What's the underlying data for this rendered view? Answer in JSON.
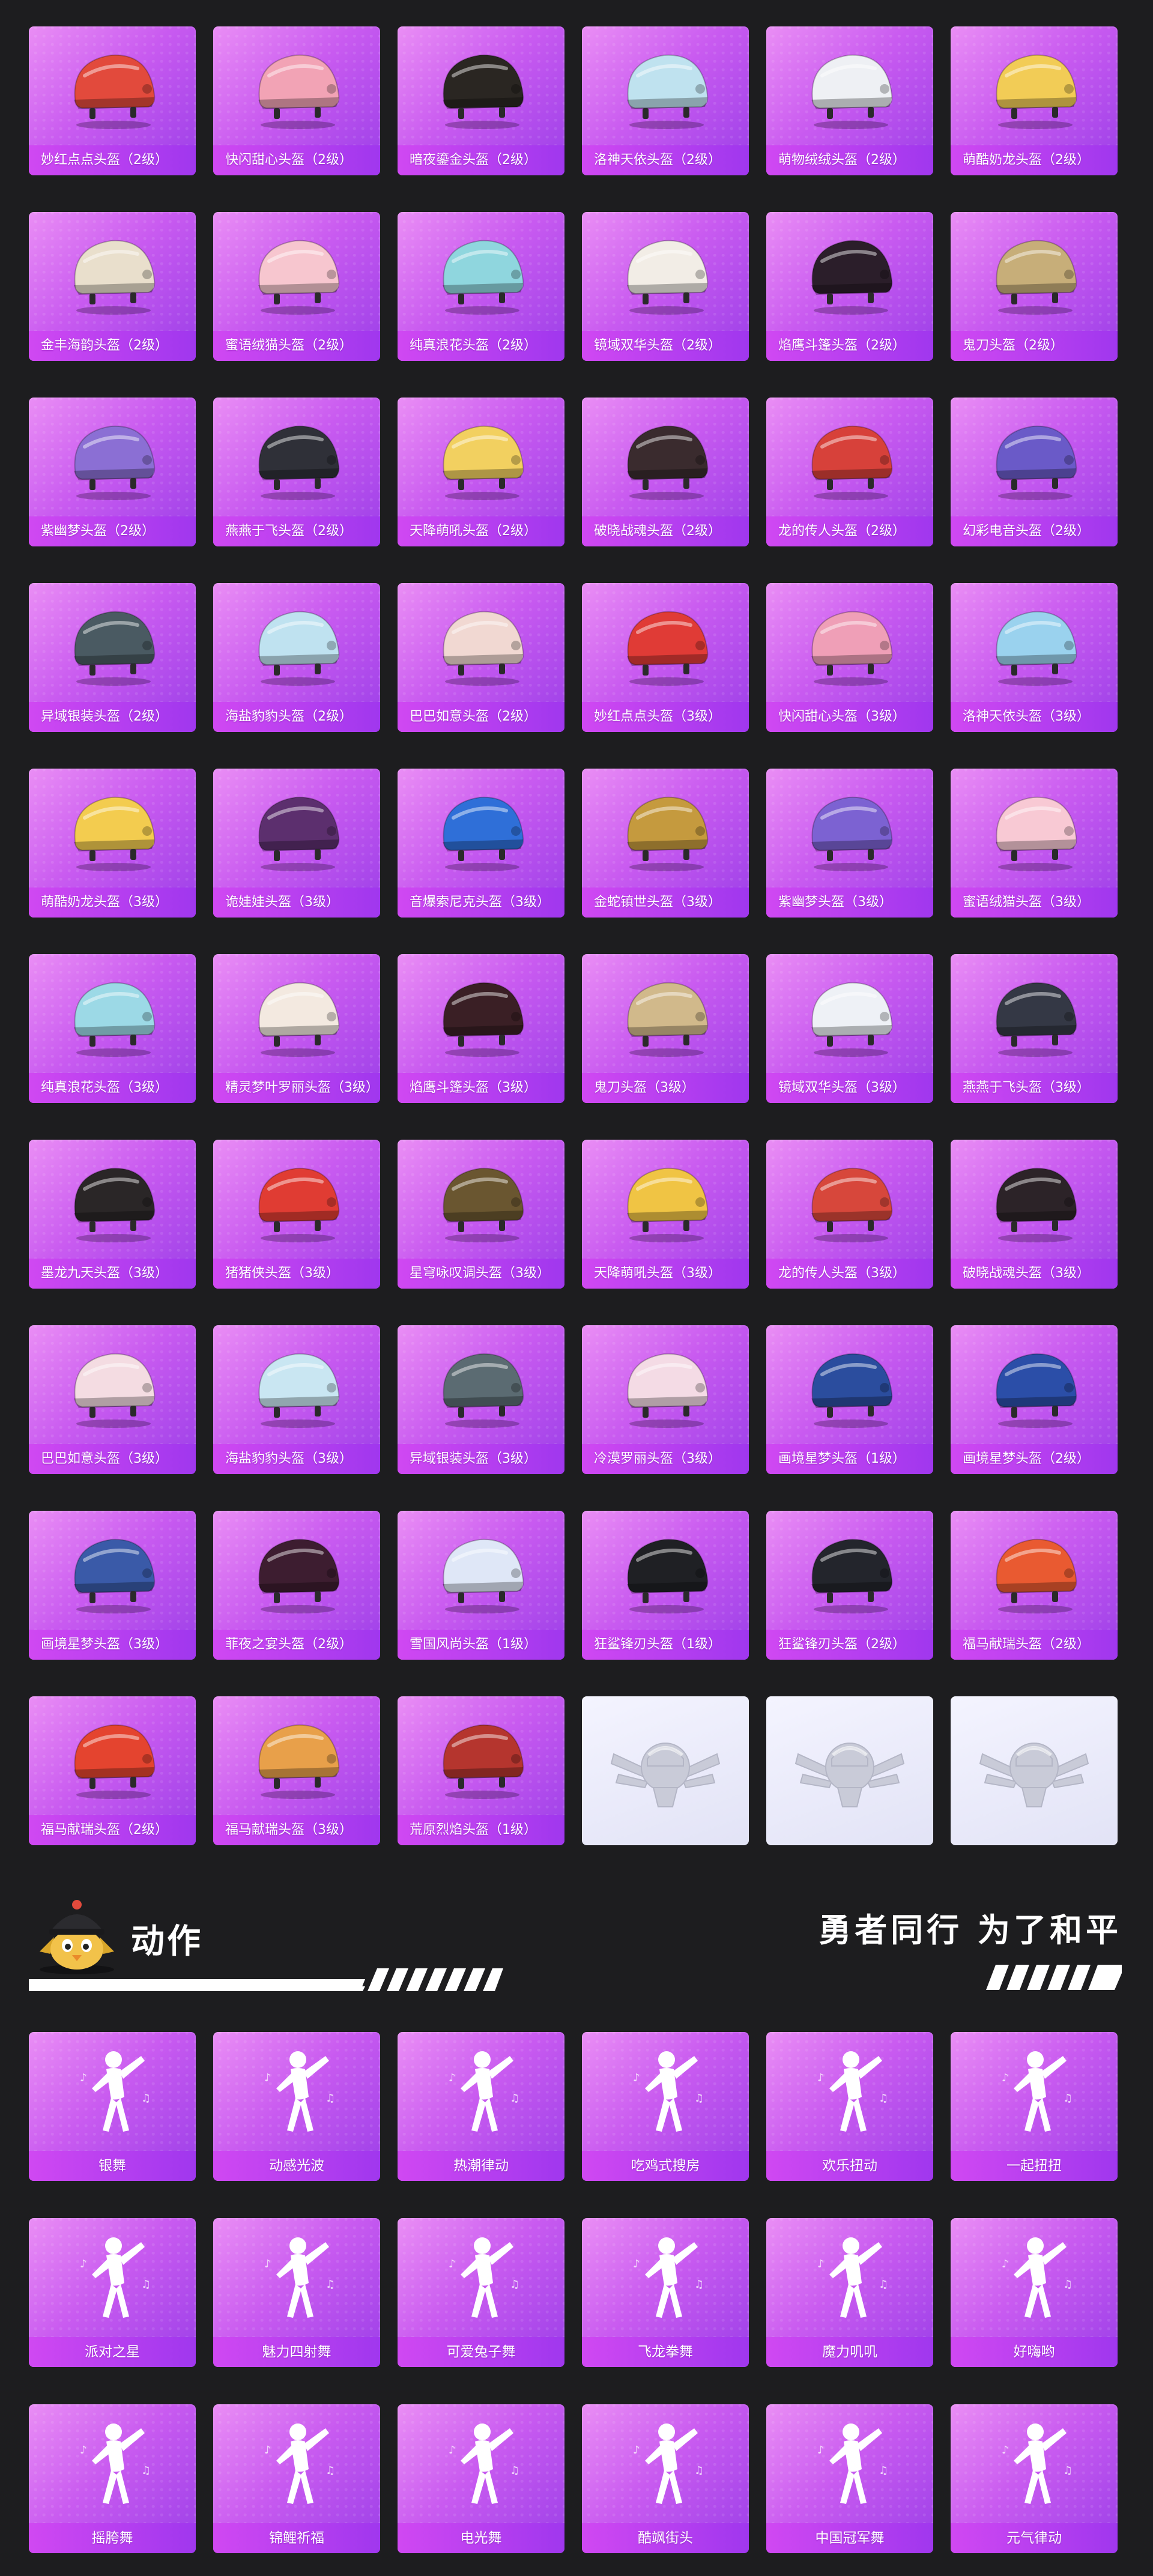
{
  "helmets": [
    {
      "label": "妙红点点头盔（2级）",
      "color": "#e24a3c"
    },
    {
      "label": "快闪甜心头盔（2级）",
      "color": "#f2a3b5"
    },
    {
      "label": "暗夜鎏金头盔（2级）",
      "color": "#2a2622"
    },
    {
      "label": "洛神天依头盔（2级）",
      "color": "#bfe2ef"
    },
    {
      "label": "萌物绒绒头盔（2级）",
      "color": "#eef0f4"
    },
    {
      "label": "萌酷奶龙头盔（2级）",
      "color": "#f2cc56"
    },
    {
      "label": "金丰海韵头盔（2级）",
      "color": "#e9dfcc"
    },
    {
      "label": "蜜语绒猫头盔（2级）",
      "color": "#f7c6cf"
    },
    {
      "label": "纯真浪花头盔（2级）",
      "color": "#8fd6de"
    },
    {
      "label": "镜域双华头盔（2级）",
      "color": "#f2ede6"
    },
    {
      "label": "焰鹰斗篷头盔（2级）",
      "color": "#2b1e2a"
    },
    {
      "label": "鬼刀头盔（2级）",
      "color": "#c7ae79"
    },
    {
      "label": "紫幽梦头盔（2级）",
      "color": "#8b6fd4"
    },
    {
      "label": "燕燕于飞头盔（2级）",
      "color": "#2f3038"
    },
    {
      "label": "天降萌吼头盔（2级）",
      "color": "#f2d060"
    },
    {
      "label": "破晓战魂头盔（2级）",
      "color": "#3a2b2e"
    },
    {
      "label": "龙的传人头盔（2级）",
      "color": "#d7413a"
    },
    {
      "label": "幻彩电音头盔（2级）",
      "color": "#6a5ac8"
    },
    {
      "label": "异域银装头盔（2级）",
      "color": "#4a5a62"
    },
    {
      "label": "海盐豹豹头盔（2级）",
      "color": "#bfe2f0"
    },
    {
      "label": "巴巴如意头盔（2级）",
      "color": "#f1d8d2"
    },
    {
      "label": "妙红点点头盔（3级）",
      "color": "#e03b36"
    },
    {
      "label": "快闪甜心头盔（3级）",
      "color": "#ef9fb7"
    },
    {
      "label": "洛神天依头盔（3级）",
      "color": "#9ad2ee"
    },
    {
      "label": "萌酷奶龙头盔（3级）",
      "color": "#f3cc4f"
    },
    {
      "label": "诡娃娃头盔（3级）",
      "color": "#5c2f6e"
    },
    {
      "label": "音爆索尼克头盔（3级）",
      "color": "#2f6fd8"
    },
    {
      "label": "金蛇镇世头盔（3级）",
      "color": "#c59a3e"
    },
    {
      "label": "紫幽梦头盔（3级）",
      "color": "#7c62d2"
    },
    {
      "label": "蜜语绒猫头盔（3级）",
      "color": "#f8c9d4"
    },
    {
      "label": "纯真浪花头盔（3级）",
      "color": "#9cd9e6"
    },
    {
      "label": "精灵梦叶罗丽头盔（3级）",
      "color": "#f3e9e0"
    },
    {
      "label": "焰鹰斗篷头盔（3级）",
      "color": "#3a1f25"
    },
    {
      "label": "鬼刀头盔（3级）",
      "color": "#d1b98b"
    },
    {
      "label": "镜域双华头盔（3级）",
      "color": "#eef1f6"
    },
    {
      "label": "燕燕于飞头盔（3级）",
      "color": "#343845"
    },
    {
      "label": "墨龙九天头盔（3级）",
      "color": "#2a2627"
    },
    {
      "label": "猪猪侠头盔（3级）",
      "color": "#e03c33"
    },
    {
      "label": "星穹咏叹调头盔（3级）",
      "color": "#6a5630"
    },
    {
      "label": "天降萌吼头盔（3级）",
      "color": "#f0c444"
    },
    {
      "label": "龙的传人头盔（3级）",
      "color": "#d7473b"
    },
    {
      "label": "破晓战魂头盔（3级）",
      "color": "#2c2328"
    },
    {
      "label": "巴巴如意头盔（3级）",
      "color": "#f4dce2"
    },
    {
      "label": "海盐豹豹头盔（3级）",
      "color": "#c9e6f2"
    },
    {
      "label": "异域银装头盔（3级）",
      "color": "#5b6b72"
    },
    {
      "label": "冷漠罗丽头盔（3级）",
      "color": "#f4dbe5"
    },
    {
      "label": "画境星梦头盔（1级）",
      "color": "#2b4d9e"
    },
    {
      "label": "画境星梦头盔（2级）",
      "color": "#2b4ea8"
    },
    {
      "label": "画境星梦头盔（3级）",
      "color": "#3a5aa8"
    },
    {
      "label": "菲夜之宴头盔（2级）",
      "color": "#3d1d30"
    },
    {
      "label": "雪国风尚头盔（1级）",
      "color": "#dfe7f7"
    },
    {
      "label": "狂鲨锋刃头盔（1级）",
      "color": "#1f2024"
    },
    {
      "label": "狂鲨锋刃头盔（2级）",
      "color": "#23252c"
    },
    {
      "label": "福马献瑞头盔（2级）",
      "color": "#e95a31"
    },
    {
      "label": "福马献瑞头盔（2级）",
      "color": "#e4442f"
    },
    {
      "label": "福马献瑞头盔（3级）",
      "color": "#e8a04a"
    },
    {
      "label": "荒原烈焰头盔（1级）",
      "color": "#b5352e"
    }
  ],
  "placeholders": [
    {
      "icon": "pubg-emblem-icon"
    },
    {
      "icon": "pubg-emblem-icon"
    },
    {
      "icon": "pubg-emblem-icon"
    }
  ],
  "section": {
    "title": "动作",
    "tagline": "勇者同行 为了和平",
    "mascot_icon": "chick-mascot-icon"
  },
  "emotes": [
    {
      "label": "银舞"
    },
    {
      "label": "动感光波"
    },
    {
      "label": "热潮律动"
    },
    {
      "label": "吃鸡式搜房"
    },
    {
      "label": "欢乐扭动"
    },
    {
      "label": "一起扭扭"
    },
    {
      "label": "派对之星"
    },
    {
      "label": "魅力四射舞"
    },
    {
      "label": "可爱兔子舞"
    },
    {
      "label": "飞龙拳舞"
    },
    {
      "label": "魔力叽叽"
    },
    {
      "label": "好嗨哟"
    },
    {
      "label": "摇胯舞"
    },
    {
      "label": "锦鲤祈福"
    },
    {
      "label": "电光舞"
    },
    {
      "label": "酷飒街头"
    },
    {
      "label": "中国冠军舞"
    },
    {
      "label": "元气律动"
    }
  ],
  "colors": {
    "background": "#1d1d1f",
    "card_top": "#ea8ef5",
    "card_bottom": "#9b3fe8",
    "label_bar": "#c043f0",
    "text": "#ffffff"
  }
}
